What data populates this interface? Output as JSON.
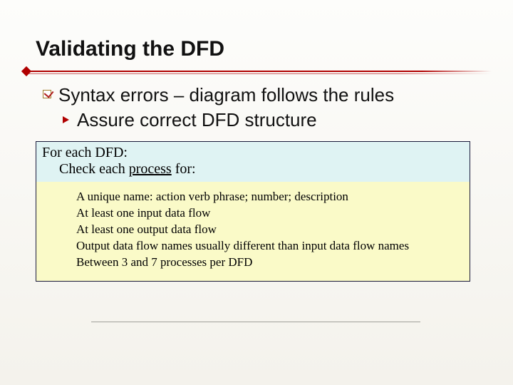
{
  "title": "Validating the DFD",
  "bullets": {
    "level1": "Syntax errors – diagram follows the rules",
    "level2": "Assure correct DFD structure"
  },
  "box": {
    "heading_line1": "For each DFD:",
    "heading_line2_prefix": "Check each ",
    "heading_line2_under": "process",
    "heading_line2_suffix": " for:",
    "items": [
      "A unique name: action verb phrase; number; description",
      "At least one input data flow",
      "At least one output data flow",
      "Output data flow names usually different than input data flow names",
      "Between 3 and 7 processes per DFD"
    ]
  }
}
